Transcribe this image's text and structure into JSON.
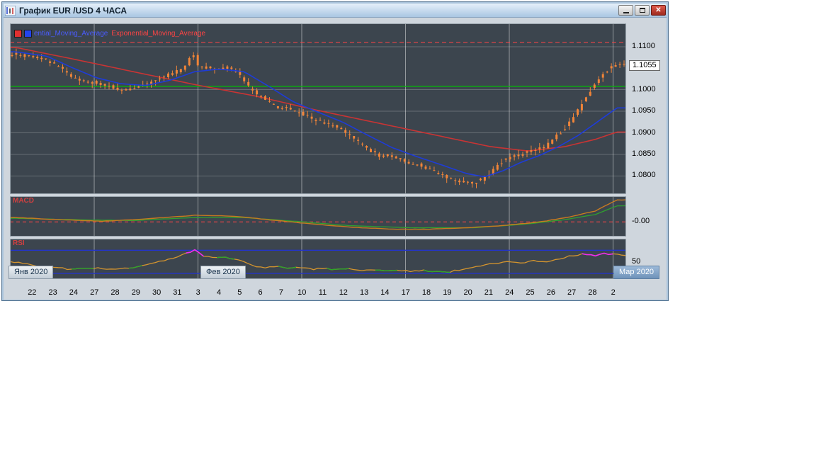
{
  "window": {
    "title": "График EUR /USD  4 ЧАСА",
    "controls": {
      "close": "✕"
    }
  },
  "legend": {
    "ma_blue": "ential_Moving_Average",
    "ma_red": "Exponential_Moving_Average"
  },
  "panes": {
    "macd_label": "MACD",
    "rsi_label": "RSI",
    "macd_axis_label": "-0.00",
    "rsi_axis_label": "50"
  },
  "price_axis": {
    "grid_labels": [
      "1.1100",
      "1.1000",
      "1.0950",
      "1.0900",
      "1.0850",
      "1.0800"
    ],
    "current": "1.1055"
  },
  "x_axis": {
    "ticks": [
      "22",
      "23",
      "24",
      "27",
      "28",
      "29",
      "30",
      "31",
      "3",
      "4",
      "5",
      "6",
      "7",
      "10",
      "11",
      "12",
      "13",
      "14",
      "17",
      "18",
      "19",
      "20",
      "21",
      "24",
      "25",
      "26",
      "27",
      "28",
      "2"
    ],
    "months": [
      "Янв 2020",
      "Фев 2020",
      "Мар 2020"
    ]
  },
  "colors": {
    "pane_bg": "#3c454e",
    "grid": "rgba(255,255,255,0.22)",
    "vgrid": "rgba(255,255,255,0.45)",
    "pane_border": "#9aa5ae",
    "candle": "#f08438",
    "ma_blue": "#1e3cd8",
    "ma_red": "#c93434",
    "level_red": "#ff4545",
    "level_green": "#00c000",
    "macd_line": "#c87a20",
    "macd_signal": "#2fa02f",
    "rsi_line": "#d5952e",
    "rsi_level": "#2334cc",
    "rsi_magenta": "#f02cf0",
    "rsi_green": "#28a828"
  },
  "chart_data": {
    "type": "candlestick",
    "title": "EUR/USD 4H with Exponential Moving Averages, MACD, RSI",
    "price_range": [
      1.0758,
      1.1154
    ],
    "macd_range": [
      -0.002,
      0.0035
    ],
    "rsi_range": [
      20,
      90
    ],
    "levels": {
      "resistance": 1.111,
      "support": 1.1008
    },
    "rsi_levels": [
      70,
      30
    ],
    "candles_count": 146,
    "candle_style": {
      "body_jitter": 0.0008,
      "wick_jitter": 0.0011,
      "body_width": 3
    },
    "close_path": [
      [
        0.01,
        1.1082
      ],
      [
        0.036,
        1.1078
      ],
      [
        0.06,
        1.1072
      ],
      [
        0.09,
        1.1048
      ],
      [
        0.103,
        1.1032
      ],
      [
        0.12,
        1.1022
      ],
      [
        0.137,
        1.1018
      ],
      [
        0.155,
        1.1012
      ],
      [
        0.17,
        1.1008
      ],
      [
        0.19,
        1.0998
      ],
      [
        0.204,
        1.1002
      ],
      [
        0.22,
        1.1012
      ],
      [
        0.237,
        1.1018
      ],
      [
        0.255,
        1.103
      ],
      [
        0.27,
        1.104
      ],
      [
        0.285,
        1.1045
      ],
      [
        0.296,
        1.1072
      ],
      [
        0.302,
        1.1088
      ],
      [
        0.31,
        1.1058
      ],
      [
        0.325,
        1.1052
      ],
      [
        0.338,
        1.105
      ],
      [
        0.355,
        1.1052
      ],
      [
        0.371,
        1.1046
      ],
      [
        0.39,
        1.101
      ],
      [
        0.405,
        1.0992
      ],
      [
        0.42,
        1.0975
      ],
      [
        0.438,
        1.0962
      ],
      [
        0.455,
        1.0955
      ],
      [
        0.471,
        1.0948
      ],
      [
        0.49,
        1.0938
      ],
      [
        0.505,
        1.0928
      ],
      [
        0.52,
        1.0922
      ],
      [
        0.539,
        1.0912
      ],
      [
        0.555,
        1.0895
      ],
      [
        0.572,
        1.0878
      ],
      [
        0.59,
        1.0858
      ],
      [
        0.606,
        1.0845
      ],
      [
        0.62,
        1.0848
      ],
      [
        0.639,
        1.0838
      ],
      [
        0.655,
        1.083
      ],
      [
        0.672,
        1.0824
      ],
      [
        0.69,
        1.0812
      ],
      [
        0.707,
        1.0802
      ],
      [
        0.72,
        1.0795
      ],
      [
        0.74,
        1.0786
      ],
      [
        0.755,
        1.0782
      ],
      [
        0.773,
        1.0792
      ],
      [
        0.79,
        1.0815
      ],
      [
        0.807,
        1.0838
      ],
      [
        0.823,
        1.0848
      ],
      [
        0.84,
        1.0852
      ],
      [
        0.857,
        1.086
      ],
      [
        0.874,
        1.0868
      ],
      [
        0.89,
        1.089
      ],
      [
        0.907,
        1.0912
      ],
      [
        0.925,
        1.0948
      ],
      [
        0.94,
        1.0985
      ],
      [
        0.955,
        1.1012
      ],
      [
        0.97,
        1.104
      ],
      [
        0.985,
        1.1056
      ]
    ],
    "ma_blue": [
      [
        0.01,
        1.1088
      ],
      [
        0.06,
        1.1078
      ],
      [
        0.1,
        1.1052
      ],
      [
        0.14,
        1.1028
      ],
      [
        0.18,
        1.1014
      ],
      [
        0.22,
        1.101
      ],
      [
        0.26,
        1.1022
      ],
      [
        0.3,
        1.1042
      ],
      [
        0.34,
        1.1048
      ],
      [
        0.38,
        1.1042
      ],
      [
        0.42,
        1.1008
      ],
      [
        0.46,
        1.0972
      ],
      [
        0.5,
        1.0948
      ],
      [
        0.54,
        1.0925
      ],
      [
        0.58,
        1.0895
      ],
      [
        0.62,
        1.0866
      ],
      [
        0.66,
        1.0845
      ],
      [
        0.7,
        1.0826
      ],
      [
        0.74,
        1.0806
      ],
      [
        0.77,
        1.0798
      ],
      [
        0.8,
        1.0812
      ],
      [
        0.83,
        1.0832
      ],
      [
        0.86,
        1.0848
      ],
      [
        0.89,
        1.0868
      ],
      [
        0.92,
        1.0892
      ],
      [
        0.95,
        1.0922
      ],
      [
        0.985,
        1.0958
      ]
    ],
    "ma_red": [
      [
        0.01,
        1.1098
      ],
      [
        0.1,
        1.1072
      ],
      [
        0.2,
        1.1042
      ],
      [
        0.3,
        1.1012
      ],
      [
        0.4,
        1.0985
      ],
      [
        0.5,
        1.0952
      ],
      [
        0.6,
        1.0922
      ],
      [
        0.7,
        1.0892
      ],
      [
        0.78,
        1.0868
      ],
      [
        0.84,
        1.0858
      ],
      [
        0.9,
        1.0868
      ],
      [
        0.95,
        1.0885
      ],
      [
        0.985,
        1.0902
      ]
    ],
    "macd_line": [
      [
        0.01,
        0.0006
      ],
      [
        0.08,
        0.0003
      ],
      [
        0.15,
        0.0001
      ],
      [
        0.22,
        0.0004
      ],
      [
        0.3,
        0.0009
      ],
      [
        0.36,
        0.0008
      ],
      [
        0.42,
        0.0003
      ],
      [
        0.48,
        -0.0002
      ],
      [
        0.55,
        -0.0007
      ],
      [
        0.62,
        -0.001
      ],
      [
        0.68,
        -0.001
      ],
      [
        0.74,
        -0.0008
      ],
      [
        0.8,
        -0.0005
      ],
      [
        0.86,
        0.0
      ],
      [
        0.91,
        0.0007
      ],
      [
        0.95,
        0.0015
      ],
      [
        0.985,
        0.003
      ]
    ],
    "macd_signal": [
      [
        0.01,
        0.0005
      ],
      [
        0.1,
        0.0003
      ],
      [
        0.2,
        0.0002
      ],
      [
        0.3,
        0.0006
      ],
      [
        0.38,
        0.0006
      ],
      [
        0.46,
        0.0001
      ],
      [
        0.55,
        -0.0005
      ],
      [
        0.65,
        -0.0008
      ],
      [
        0.75,
        -0.0008
      ],
      [
        0.84,
        -0.0003
      ],
      [
        0.9,
        0.0003
      ],
      [
        0.95,
        0.001
      ],
      [
        0.985,
        0.0022
      ]
    ],
    "rsi_line": [
      [
        0.01,
        50
      ],
      [
        0.04,
        44
      ],
      [
        0.07,
        40
      ],
      [
        0.1,
        37
      ],
      [
        0.13,
        40
      ],
      [
        0.16,
        37
      ],
      [
        0.19,
        39
      ],
      [
        0.22,
        44
      ],
      [
        0.25,
        52
      ],
      [
        0.275,
        60
      ],
      [
        0.29,
        66
      ],
      [
        0.3,
        70
      ],
      [
        0.315,
        60
      ],
      [
        0.33,
        57
      ],
      [
        0.35,
        58
      ],
      [
        0.37,
        54
      ],
      [
        0.39,
        44
      ],
      [
        0.41,
        40
      ],
      [
        0.43,
        42
      ],
      [
        0.45,
        38
      ],
      [
        0.47,
        40
      ],
      [
        0.49,
        37
      ],
      [
        0.51,
        39
      ],
      [
        0.53,
        36
      ],
      [
        0.55,
        38
      ],
      [
        0.57,
        35
      ],
      [
        0.59,
        37
      ],
      [
        0.61,
        34
      ],
      [
        0.63,
        36
      ],
      [
        0.65,
        33
      ],
      [
        0.67,
        35
      ],
      [
        0.69,
        33
      ],
      [
        0.71,
        32
      ],
      [
        0.73,
        36
      ],
      [
        0.75,
        40
      ],
      [
        0.77,
        44
      ],
      [
        0.79,
        48
      ],
      [
        0.81,
        50
      ],
      [
        0.83,
        48
      ],
      [
        0.85,
        52
      ],
      [
        0.87,
        50
      ],
      [
        0.89,
        55
      ],
      [
        0.91,
        60
      ],
      [
        0.93,
        63
      ],
      [
        0.95,
        60
      ],
      [
        0.965,
        64
      ],
      [
        0.985,
        62
      ]
    ],
    "rsi_magenta_segments": [
      [
        0.285,
        0.315
      ],
      [
        0.925,
        0.985
      ]
    ],
    "rsi_green_segments": [
      [
        0.1,
        0.14
      ],
      [
        0.19,
        0.215
      ],
      [
        0.33,
        0.365
      ],
      [
        0.43,
        0.47
      ],
      [
        0.51,
        0.555
      ],
      [
        0.59,
        0.635
      ],
      [
        0.67,
        0.715
      ]
    ],
    "layout": {
      "tick_start": 0.036,
      "tick_end": 0.979,
      "grid_tick_indices": [
        3,
        8,
        13,
        18,
        23,
        28
      ],
      "samples": 140
    }
  }
}
